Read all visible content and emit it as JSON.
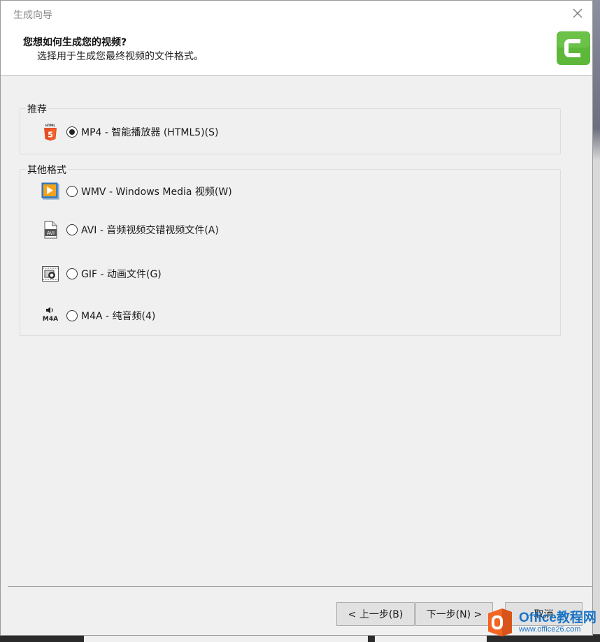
{
  "window": {
    "title": "生成向导"
  },
  "header": {
    "title": "您想如何生成您的视频?",
    "subtitle": "选择用于生成您最终视频的文件格式。"
  },
  "groups": [
    {
      "label": "推荐",
      "options": [
        {
          "label": "MP4 - 智能播放器 (HTML5)(S)",
          "icon": "html5-icon",
          "selected": true
        }
      ]
    },
    {
      "label": "其他格式",
      "options": [
        {
          "label": "WMV - Windows Media 视频(W)",
          "icon": "wmv-media-icon",
          "selected": false
        },
        {
          "label": "AVI - 音频视频交错视频文件(A)",
          "icon": "avi-file-icon",
          "selected": false,
          "icon_text": "AVI"
        },
        {
          "label": "GIF - 动画文件(G)",
          "icon": "gif-animation-icon",
          "selected": false
        },
        {
          "label": "M4A - 纯音频(4)",
          "icon": "m4a-audio-icon",
          "selected": false,
          "icon_text": "M4A"
        }
      ]
    }
  ],
  "buttons": {
    "back": "< 上一步(B)",
    "next": "下一步(N) >",
    "cancel": "取消"
  },
  "watermark": {
    "main": "Office教程网",
    "sub": "www.office26.com"
  },
  "colors": {
    "camtasia_green": "#5db83a",
    "html5_orange": "#e44d26",
    "watermark_blue": "#1a73c6",
    "watermark_orange": "#f26522"
  }
}
